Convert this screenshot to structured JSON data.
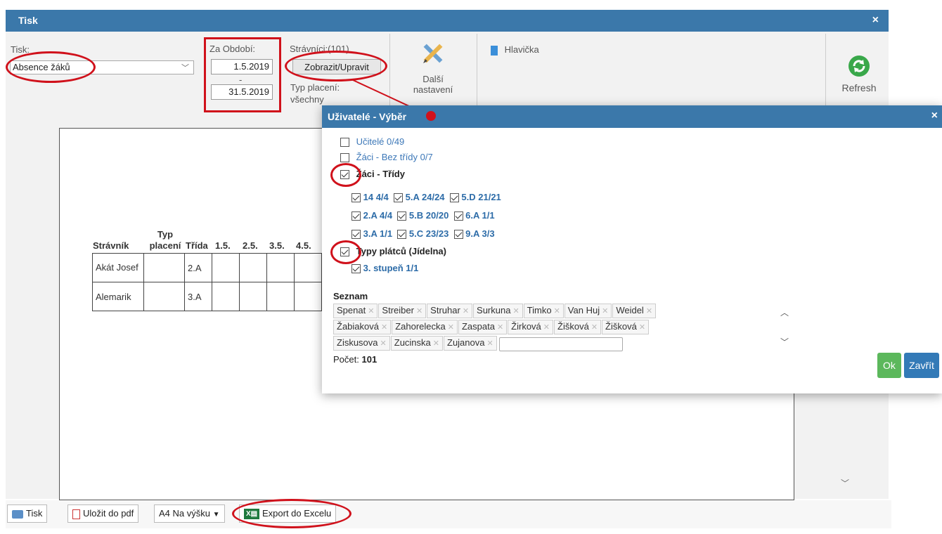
{
  "window": {
    "title": "Tisk",
    "close": "×"
  },
  "toolbar": {
    "tisk_label": "Tisk:",
    "tisk_value": "Absence žáků",
    "period_label": "Za Období:",
    "date_from": "1.5.2019",
    "date_sep": "-",
    "date_to": "31.5.2019",
    "stravnici_label": "Strávníci:(101)",
    "zobrazit_button": "Zobrazit/Upravit",
    "typ_placeni_label": "Typ placení:",
    "typ_placeni_value": "všechny",
    "dalsi_line1": "Další",
    "dalsi_line2": "nastavení",
    "hlavicka": "Hlavička",
    "refresh": "Refresh"
  },
  "preview_table": {
    "headers": [
      "Strávník",
      "Typ placení",
      "Třída",
      "1.5.",
      "2.5.",
      "3.5.",
      "4.5."
    ],
    "rows": [
      {
        "name": "Akát Josef",
        "typ": "",
        "trida": "2.A"
      },
      {
        "name": "Alemarik",
        "typ": "",
        "trida": "3.A"
      }
    ]
  },
  "bottombar": {
    "tisk": "Tisk",
    "pdf": "Uložit do pdf",
    "format": "A4 Na výšku",
    "excel": "Export do Excelu"
  },
  "dialog": {
    "title": "Uživatelé - Výběr",
    "close": "×",
    "groups": {
      "ucitele": "Učitelé 0/49",
      "bez_tridy": "Žáci - Bez třídy 0/7",
      "tridy": "Žáci - Třídy",
      "typy": "Typy plátců (Jídelna)"
    },
    "classes": [
      "14 4/4",
      "5.A 24/24",
      "5.D 21/21",
      "2.A 4/4",
      "5.B 20/20",
      "6.A 1/1",
      "3.A 1/1",
      "5.C 23/23",
      "9.A 3/3"
    ],
    "payer_types": [
      "3. stupeň 1/1"
    ],
    "seznam_label": "Seznam",
    "tags_row1": [
      "Spenat",
      "Streiber",
      "Struhar",
      "Surkuna",
      "Timko",
      "Van Huj",
      "Weidel"
    ],
    "tags_row2": [
      "Žabiaková",
      "Zahorelecka",
      "Zaspata",
      "Žirková",
      "Žišková",
      "Žišková"
    ],
    "tags_row3": [
      "Ziskusova",
      "Zucinska",
      "Zujanova"
    ],
    "count_label": "Počet:",
    "count_value": "101",
    "ok": "Ok",
    "zavrit": "Zavřít"
  },
  "colors": {
    "title_bar": "#3b78aa",
    "annotation_red": "#d0111b",
    "ok_green": "#5cb85c",
    "zavrit_blue": "#337ab7"
  }
}
